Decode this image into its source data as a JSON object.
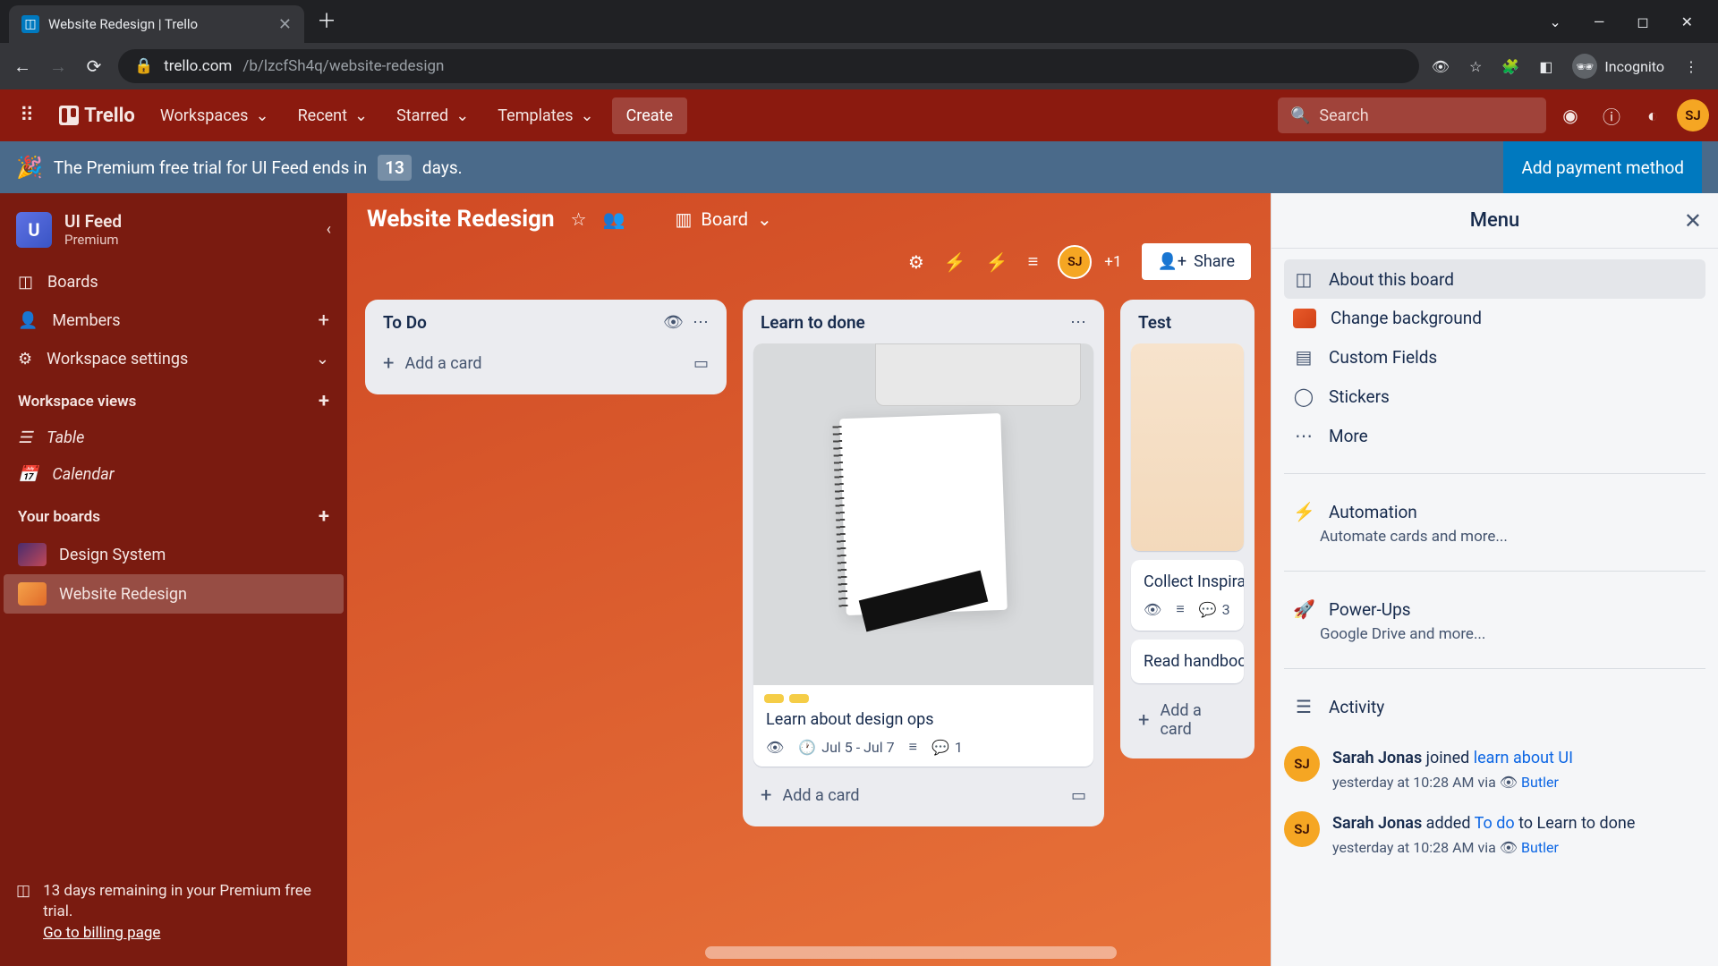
{
  "browser": {
    "tab_title": "Website Redesign | Trello",
    "url_host": "trello.com",
    "url_path": "/b/lzcfSh4q/website-redesign",
    "incognito_label": "Incognito"
  },
  "topbar": {
    "logo": "Trello",
    "workspaces": "Workspaces",
    "recent": "Recent",
    "starred": "Starred",
    "templates": "Templates",
    "create": "Create",
    "search_placeholder": "Search"
  },
  "banner": {
    "text_pre": "The Premium free trial for UI Feed ends in",
    "days": "13",
    "text_post": "days.",
    "cta": "Add payment method"
  },
  "sidebar": {
    "workspace_initial": "U",
    "workspace_name": "UI Feed",
    "workspace_plan": "Premium",
    "nav": {
      "boards": "Boards",
      "members": "Members",
      "settings": "Workspace settings"
    },
    "section_views": "Workspace views",
    "views": {
      "table": "Table",
      "calendar": "Calendar"
    },
    "section_boards": "Your boards",
    "boards": [
      {
        "name": "Design System"
      },
      {
        "name": "Website Redesign"
      }
    ],
    "trial": {
      "line1": "13 days remaining in your Premium free trial.",
      "cta": "Go to billing page"
    }
  },
  "board": {
    "title": "Website Redesign",
    "view_label": "Board",
    "plus_one": "+1",
    "share": "Share"
  },
  "lists": [
    {
      "title": "To Do",
      "add_card": "Add a card",
      "cards": []
    },
    {
      "title": "Learn to done",
      "add_card": "Add a card",
      "cards": [
        {
          "title": "Learn about design ops",
          "date": "Jul 5 - Jul 7",
          "comments": "1"
        }
      ]
    },
    {
      "title": "Test",
      "add_card": "Add a card",
      "cards_simple": [
        {
          "title": "Collect Inspiration",
          "comments": "3"
        },
        {
          "title": "Read handbook"
        }
      ]
    }
  ],
  "menu": {
    "title": "Menu",
    "about": "About this board",
    "change_bg": "Change background",
    "custom_fields": "Custom Fields",
    "stickers": "Stickers",
    "more": "More",
    "automation": "Automation",
    "automation_sub": "Automate cards and more...",
    "powerups": "Power-Ups",
    "powerups_sub": "Google Drive and more...",
    "activity": "Activity",
    "activities": [
      {
        "user": "Sarah Jonas",
        "action": " joined ",
        "link": "learn about UI",
        "meta_pre": "yesterday at 10:28 AM via ",
        "meta_link": "Butler"
      },
      {
        "user": "Sarah Jonas",
        "action": " added ",
        "link": "To do",
        "suffix": " to Learn to done",
        "meta_pre": "yesterday at 10:28 AM via ",
        "meta_link": "Butler"
      }
    ]
  }
}
